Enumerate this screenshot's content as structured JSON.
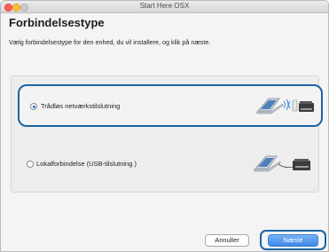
{
  "window": {
    "title": "Start Here OSX"
  },
  "main": {
    "heading": "Forbindelsestype",
    "instruction": "Vælg forbindelsestype for den enhed, du vil installere, og klik på næste."
  },
  "options": [
    {
      "label": "Trådløs netværkstilslutning",
      "selected": true,
      "illustration": "wireless-connection-icon"
    },
    {
      "label": "Lokalforbindelse (USB-tilslutning )",
      "selected": false,
      "illustration": "usb-connection-icon"
    }
  ],
  "buttons": {
    "cancel_label": "Annuller",
    "next_label": "Næste"
  },
  "colors": {
    "highlight": "#1b63a6",
    "primary_button": "#3d87e6",
    "radio_selected": "#2a6fc9"
  }
}
